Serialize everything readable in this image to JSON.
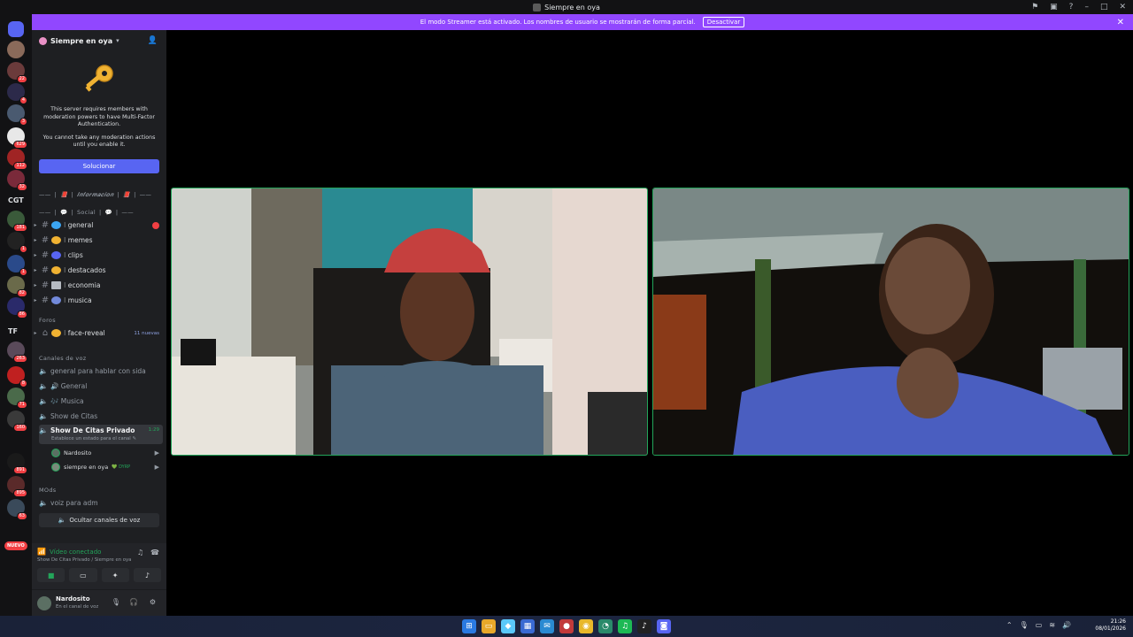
{
  "window": {
    "title": "Siempre en oya"
  },
  "streamer_mode": {
    "message": "El modo Streamer está activado. Los nombres de usuario se mostrarán de forma parcial.",
    "button": "Desactivar"
  },
  "server": {
    "name": "Siempre en oya"
  },
  "mfa": {
    "line1": "This server requires members with moderation powers to have Multi-Factor Authentication.",
    "line2": "You cannot take any moderation actions until you enable it.",
    "button": "Solucionar"
  },
  "guild_badges": [
    "22",
    "4",
    "3",
    "629",
    "112",
    "32",
    "181",
    "1",
    "1",
    "82",
    "86",
    "263",
    "8",
    "71",
    "160",
    "891",
    "895",
    "63"
  ],
  "guild_texts": [
    "CGT",
    "TF"
  ],
  "nuevo_label": "NUEVO",
  "categories": {
    "informacion": "—— ❘ 📕 ❘ 𝑰𝒏𝒇𝒐𝒓𝒎𝒂𝒄𝒊𝒐𝒏 ❘ 📕 ❘ ——",
    "social": "—— ❘ 💬 ❘ Social ❘ 💬 ❘ ——",
    "foros": "Foros",
    "canales_voz": "Canales de voz",
    "mods": "MOds"
  },
  "text_channels": [
    {
      "name": "⁝ general",
      "emoji_color": "#3ba5f2"
    },
    {
      "name": "⁝ memes",
      "emoji_color": "#f0b232"
    },
    {
      "name": "⁝ clips",
      "emoji_color": "#5865f2"
    },
    {
      "name": "⁝ destacados",
      "emoji_color": "#f0b232"
    },
    {
      "name": "⁝ economia",
      "emoji_color": "#b5bac1"
    },
    {
      "name": "⁝ musica",
      "emoji_color": "#7289da"
    }
  ],
  "forum": {
    "name": "⁝ face-reveal",
    "tag": "11 nuevas"
  },
  "voice_channels": [
    "general para hablar con sida",
    "🔊 General",
    "🎶 Musica",
    "Show de Citas"
  ],
  "active_voice": {
    "name": "Show De Citas Privado",
    "timer": "1:29",
    "status": "Establece un estado para el canal ✎"
  },
  "voice_users": [
    {
      "name": "Nardosito"
    },
    {
      "name": "siempre en oya",
      "tag": "💚 DYRP"
    }
  ],
  "mods_channel": "voiz para adm",
  "hide_voice": "Ocultar canales de voz",
  "rtc": {
    "status": "Vídeo conectado",
    "sub": "Show De Citas Privado / Siempre en oya"
  },
  "user": {
    "name": "Nardosito",
    "sub": "En el canal de voz"
  },
  "clock": {
    "time": "21:26",
    "date": "08/01/2026"
  }
}
